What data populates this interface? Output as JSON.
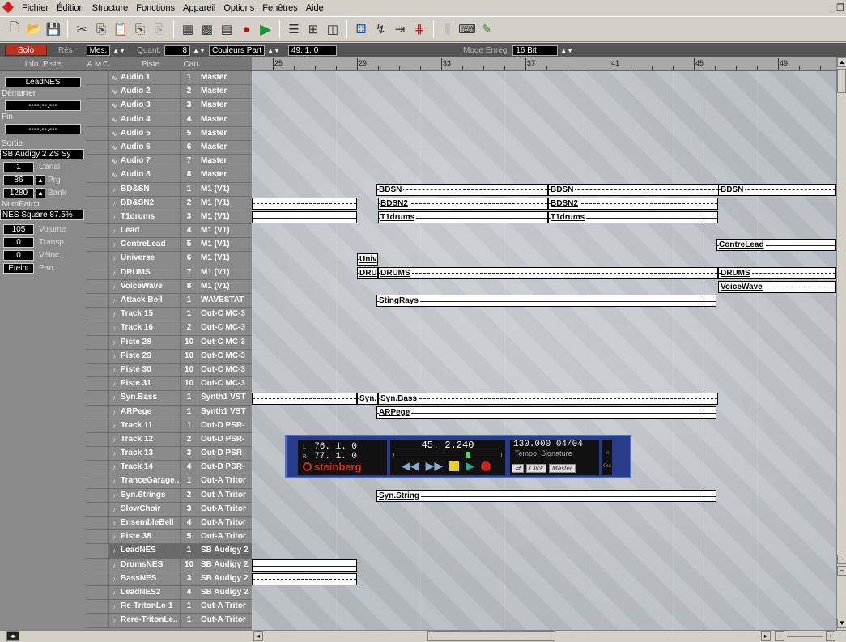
{
  "menu": {
    "items": [
      "Fichier",
      "Édition",
      "Structure",
      "Fonctions",
      "Appareil",
      "Options",
      "Fenêtres",
      "Aide"
    ]
  },
  "toolbar": {
    "icons": [
      "new-icon",
      "open-icon",
      "save-icon",
      "scissors-icon",
      "copy-icon",
      "paste-icon",
      "copy2-icon",
      "paste2-icon",
      "grid-editor-icon",
      "key-editor-icon",
      "score-icon",
      "record-icon",
      "play-icon",
      "list-icon",
      "mixer-icon",
      "device-icon",
      "drum-icon",
      "automation-icon",
      "tempo-icon",
      "quantize-icon",
      "eq-icon",
      "keyboard-icon",
      "pencil-icon"
    ]
  },
  "secbar": {
    "solo": "Solo",
    "res_label": "Rés.",
    "mes": "Mes.",
    "quant_label": "Quant.",
    "quant_value": "8",
    "couleurs": "Couleurs Part",
    "position": "49. 1. 0",
    "mode_label": "Mode Enreg.",
    "mode_value": "16 Bit"
  },
  "inspector": {
    "header": "Info. Piste",
    "track_name": "LeadNES",
    "start_label": "Démarrer",
    "start_value": "----.--.---",
    "end_label": "Fin",
    "end_value": "----.--.---",
    "output_label": "Sortie",
    "output_value": "SB Audigy 2 ZS Sy",
    "canal_value": "1",
    "canal_label": "Canal",
    "prg_value": "86",
    "prg_label": "Prg",
    "bank_value": "1280",
    "bank_label": "Bank",
    "nompatch_label": "NomPatch",
    "nompatch_value": "NES Square 87.5%",
    "volume_value": "105",
    "volume_label": "Volume",
    "transp_value": "0",
    "transp_label": "Transp.",
    "veloc_value": "0",
    "veloc_label": "Véloc.",
    "pan_value": "Éteint",
    "pan_label": "Pan."
  },
  "tracklist": {
    "headers": {
      "a": "A",
      "m": "M",
      "c": "C",
      "piste": "Piste",
      "can": "Can."
    },
    "tracks": [
      {
        "name": "Audio 1",
        "chan": "1",
        "out": "Master",
        "type": "audio"
      },
      {
        "name": "Audio 2",
        "chan": "2",
        "out": "Master",
        "type": "audio"
      },
      {
        "name": "Audio 3",
        "chan": "3",
        "out": "Master",
        "type": "audio"
      },
      {
        "name": "Audio 4",
        "chan": "4",
        "out": "Master",
        "type": "audio"
      },
      {
        "name": "Audio 5",
        "chan": "5",
        "out": "Master",
        "type": "audio"
      },
      {
        "name": "Audio 6",
        "chan": "6",
        "out": "Master",
        "type": "audio"
      },
      {
        "name": "Audio 7",
        "chan": "7",
        "out": "Master",
        "type": "audio"
      },
      {
        "name": "Audio 8",
        "chan": "8",
        "out": "Master",
        "type": "audio"
      },
      {
        "name": "BD&SN",
        "chan": "1",
        "out": "M1 (V1)",
        "type": "midi"
      },
      {
        "name": "BD&SN2",
        "chan": "2",
        "out": "M1 (V1)",
        "type": "midi"
      },
      {
        "name": "T1drums",
        "chan": "3",
        "out": "M1 (V1)",
        "type": "midi"
      },
      {
        "name": "Lead",
        "chan": "4",
        "out": "M1 (V1)",
        "type": "midi"
      },
      {
        "name": "ContreLead",
        "chan": "5",
        "out": "M1 (V1)",
        "type": "midi"
      },
      {
        "name": "Universe",
        "chan": "6",
        "out": "M1 (V1)",
        "type": "midi"
      },
      {
        "name": "DRUMS",
        "chan": "7",
        "out": "M1 (V1)",
        "type": "midi"
      },
      {
        "name": "VoiceWave",
        "chan": "8",
        "out": "M1 (V1)",
        "type": "midi"
      },
      {
        "name": "Attack Bell",
        "chan": "1",
        "out": "WAVESTAT",
        "type": "midi"
      },
      {
        "name": "Track 15",
        "chan": "1",
        "out": "Out-C MC-3",
        "type": "midi"
      },
      {
        "name": "Track 16",
        "chan": "2",
        "out": "Out-C MC-3",
        "type": "midi"
      },
      {
        "name": "Piste 28",
        "chan": "10",
        "out": "Out-C MC-3",
        "type": "midi"
      },
      {
        "name": "Piste 29",
        "chan": "10",
        "out": "Out-C MC-3",
        "type": "midi"
      },
      {
        "name": "Piste 30",
        "chan": "10",
        "out": "Out-C MC-3",
        "type": "midi"
      },
      {
        "name": "Piste 31",
        "chan": "10",
        "out": "Out-C MC-3",
        "type": "midi"
      },
      {
        "name": "Syn.Bass",
        "chan": "1",
        "out": "Synth1 VST",
        "type": "midi"
      },
      {
        "name": "ARPege",
        "chan": "1",
        "out": "Synth1 VST",
        "type": "midi"
      },
      {
        "name": "Track 11",
        "chan": "1",
        "out": "Out-D PSR-",
        "type": "midi"
      },
      {
        "name": "Track 12",
        "chan": "2",
        "out": "Out-D PSR-",
        "type": "midi"
      },
      {
        "name": "Track 13",
        "chan": "3",
        "out": "Out-D PSR-",
        "type": "midi"
      },
      {
        "name": "Track 14",
        "chan": "4",
        "out": "Out-D PSR-",
        "type": "midi"
      },
      {
        "name": "TranceGarage..",
        "chan": "1",
        "out": "Out-A Tritor",
        "type": "midi"
      },
      {
        "name": "Syn.Strings",
        "chan": "2",
        "out": "Out-A Tritor",
        "type": "midi"
      },
      {
        "name": "SlowChoir",
        "chan": "3",
        "out": "Out-A Tritor",
        "type": "midi"
      },
      {
        "name": "EnsembleBell",
        "chan": "4",
        "out": "Out-A Tritor",
        "type": "midi"
      },
      {
        "name": "Piste 38",
        "chan": "5",
        "out": "Out-A Tritor",
        "type": "midi"
      },
      {
        "name": "LeadNES",
        "chan": "1",
        "out": "SB Audigy 2",
        "type": "midi",
        "selected": true
      },
      {
        "name": "DrumsNES",
        "chan": "10",
        "out": "SB Audigy 2",
        "type": "midi"
      },
      {
        "name": "BassNES",
        "chan": "3",
        "out": "SB Audigy 2",
        "type": "midi"
      },
      {
        "name": "LeadNES2",
        "chan": "4",
        "out": "SB Audigy 2",
        "type": "midi"
      },
      {
        "name": "Re-TritonLe-1",
        "chan": "1",
        "out": "Out-A Tritor",
        "type": "midi"
      },
      {
        "name": "Rere-TritonLe..",
        "chan": "1",
        "out": "Out-A Tritor",
        "type": "midi"
      }
    ]
  },
  "arrange": {
    "ruler_marks": [
      "25",
      "29",
      "33",
      "37",
      "41",
      "45",
      "49"
    ],
    "part_labels": {
      "bdsn": "BDSN",
      "bdsn2": "BDSN2",
      "t1drums": "T1drums",
      "contrelead": "ContreLead",
      "univ": "Univ",
      "dru": "DRU",
      "drums": "DRUMS",
      "voicewave": "VoiceWave",
      "stingrays": "StingRays",
      "synbass_short": "Syn.",
      "synbass": "Syn.Bass",
      "arpege": "ARPege",
      "synstring": "Syn.String"
    }
  },
  "transport": {
    "l_key": "L",
    "l_value": "76. 1. 0",
    "r_key": "R",
    "r_value": "77. 1. 0",
    "brand": "steinberg",
    "position": "45. 2.240",
    "tempo": "130.000",
    "signature": "04/04",
    "tempo_label": "Tempo",
    "signature_label": "Signature",
    "click": "Click",
    "master": "Master",
    "in_label": "In",
    "out_label": "Out"
  }
}
